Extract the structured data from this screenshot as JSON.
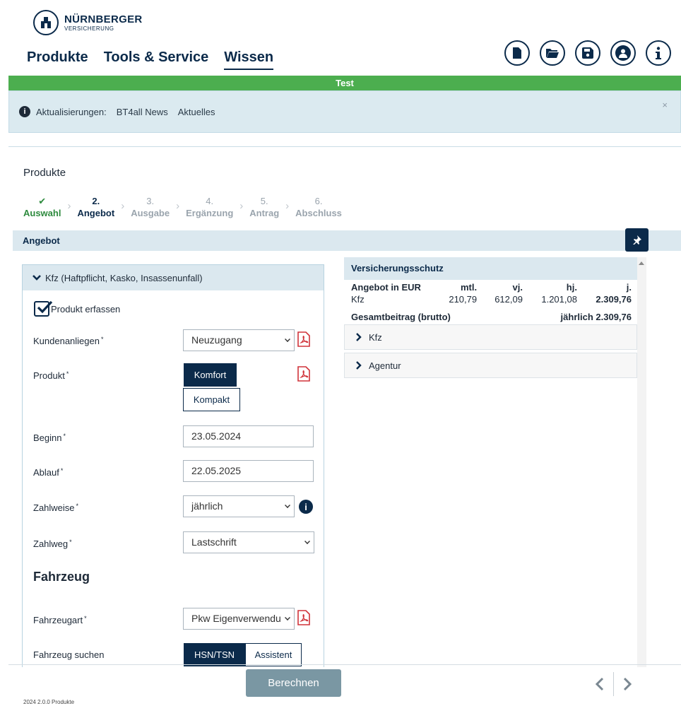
{
  "brand": {
    "name": "NÜRNBERGER",
    "sub": "VERSICHERUNG"
  },
  "nav": {
    "items": [
      "Produkte",
      "Tools & Service",
      "Wissen"
    ],
    "active": "Wissen"
  },
  "top_icons": [
    "new-file-icon",
    "open-folder-icon",
    "save-icon",
    "user-icon",
    "info-icon"
  ],
  "test_banner": "Test",
  "info_bar": {
    "label": "Aktualisierungen:",
    "links": [
      "BT4all News",
      "Aktuelles"
    ],
    "close": "×"
  },
  "page_heading": "Produkte",
  "steps": [
    {
      "num": "✔",
      "label": "Auswahl",
      "state": "done"
    },
    {
      "num": "2.",
      "label": "Angebot",
      "state": "current"
    },
    {
      "num": "3.",
      "label": "Ausgabe",
      "state": "todo"
    },
    {
      "num": "4.",
      "label": "Ergänzung",
      "state": "todo"
    },
    {
      "num": "5.",
      "label": "Antrag",
      "state": "todo"
    },
    {
      "num": "6.",
      "label": "Abschluss",
      "state": "todo"
    }
  ],
  "section_title": "Angebot",
  "left_panel": {
    "header": "Kfz  (Haftpflicht, Kasko, Insassenunfall)",
    "checkbox_label": "Produkt erfassen",
    "fields": {
      "kundenanliegen": {
        "label": "Kundenanliegen",
        "value": "Neuzugang"
      },
      "produkt": {
        "label": "Produkt",
        "options": [
          "Komfort",
          "Kompakt"
        ],
        "selected": "Komfort"
      },
      "beginn": {
        "label": "Beginn",
        "value": "23.05.2024"
      },
      "ablauf": {
        "label": "Ablauf",
        "value": "22.05.2025"
      },
      "zahlweise": {
        "label": "Zahlweise",
        "value": "jährlich"
      },
      "zahlweg": {
        "label": "Zahlweg",
        "value": "Lastschrift"
      },
      "fahrzeugart": {
        "label": "Fahrzeugart",
        "value": "Pkw Eigenverwendu"
      },
      "fahrzeug_suchen": {
        "label": "Fahrzeug suchen",
        "options": [
          "HSN/TSN",
          "Assistent"
        ],
        "selected": "HSN/TSN"
      }
    },
    "subheading": "Fahrzeug",
    "required_mark": "*"
  },
  "right_panel": {
    "title": "Versicherungsschutz",
    "table": {
      "header": [
        "Angebot in EUR",
        "mtl.",
        "vj.",
        "hj.",
        "j."
      ],
      "rows": [
        [
          "Kfz",
          "210,79",
          "612,09",
          "1.201,08",
          "2.309,76"
        ]
      ]
    },
    "total_label": "Gesamtbeitrag (brutto)",
    "total_value": "jährlich 2.309,76",
    "accordions": [
      "Kfz",
      "Agentur"
    ]
  },
  "footer": {
    "calc_button": "Berechnen",
    "version": "2024 2.0.0 Produkte"
  },
  "colors": {
    "primary": "#0b2a4a",
    "test_green": "#4cae4f",
    "info_bg": "#dbeaf0",
    "pdf_red": "#d0333a"
  }
}
